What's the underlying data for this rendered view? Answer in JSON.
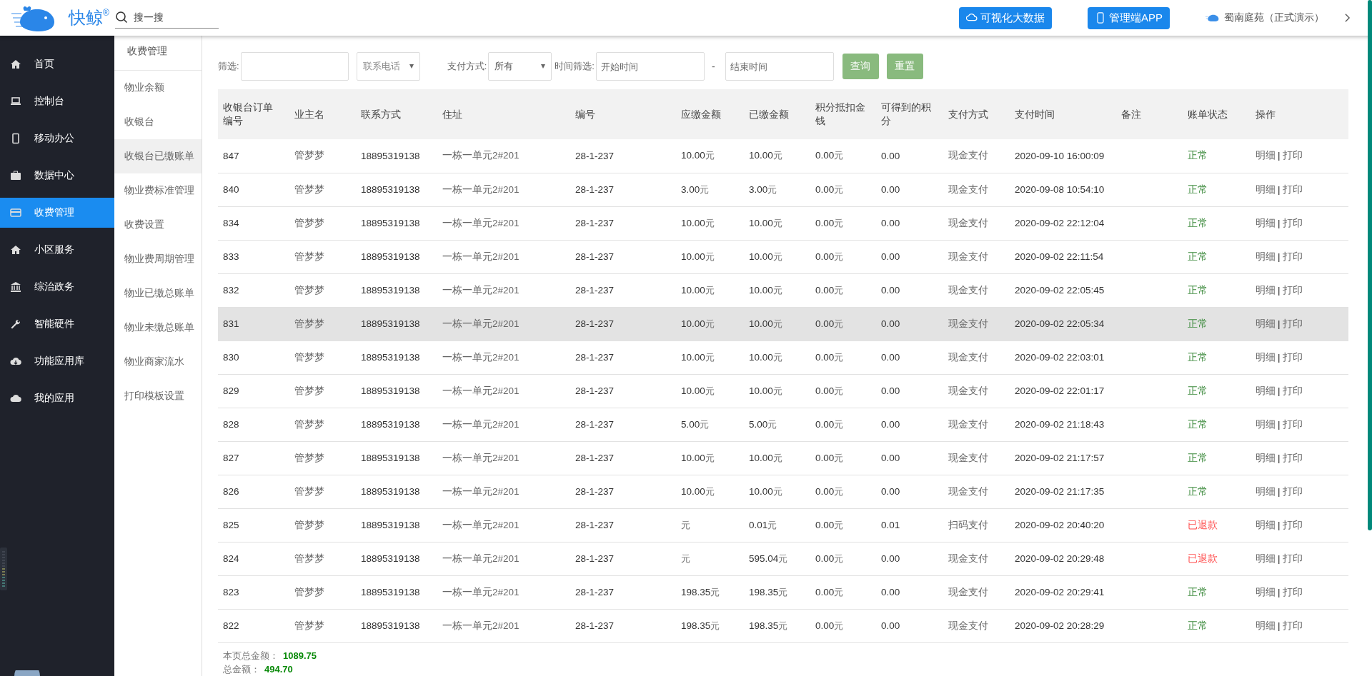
{
  "brand": {
    "name": "快鲸",
    "mark": "®"
  },
  "search": {
    "placeholder": "搜一搜"
  },
  "top_buttons": [
    {
      "label": "可视化大数据",
      "kind": "cloud"
    },
    {
      "label": "管理端APP",
      "kind": "phone"
    }
  ],
  "user": {
    "name": "蜀南庭苑（正式演示）"
  },
  "nav": [
    {
      "label": "首页",
      "kind": "home",
      "selected": false
    },
    {
      "label": "控制台",
      "kind": "laptop",
      "selected": false
    },
    {
      "label": "移动办公",
      "kind": "mobile",
      "selected": false
    },
    {
      "label": "数据中心",
      "kind": "briefcase",
      "selected": false
    },
    {
      "label": "收费管理",
      "kind": "card",
      "selected": true
    },
    {
      "label": "小区服务",
      "kind": "home",
      "selected": false
    },
    {
      "label": "综治政务",
      "kind": "bank",
      "selected": false
    },
    {
      "label": "智能硬件",
      "kind": "wrench",
      "selected": false
    },
    {
      "label": "功能应用库",
      "kind": "download",
      "selected": false
    },
    {
      "label": "我的应用",
      "kind": "cloud",
      "selected": false
    }
  ],
  "subnav": {
    "title": "收费管理",
    "items": [
      {
        "label": "物业余额",
        "selected": false
      },
      {
        "label": "收银台",
        "selected": false
      },
      {
        "label": "收银台已缴账单",
        "selected": true
      },
      {
        "label": "物业费标准管理",
        "selected": false
      },
      {
        "label": "收费设置",
        "selected": false
      },
      {
        "label": "物业费周期管理",
        "selected": false
      },
      {
        "label": "物业已缴总账单",
        "selected": false
      },
      {
        "label": "物业未缴总账单",
        "selected": false
      },
      {
        "label": "物业商家流水",
        "selected": false
      },
      {
        "label": "打印模板设置",
        "selected": false
      }
    ]
  },
  "filters": {
    "filter_label": "筛选:",
    "field_select": "联系电话",
    "pay_label": "支付方式:",
    "pay_select": "所有",
    "time_label": "时间筛选:",
    "start_placeholder": "开始时间",
    "range_sep": "-",
    "end_placeholder": "结束时间",
    "buttons": [
      "查询",
      "重置"
    ]
  },
  "table": {
    "columns": [
      "收银台订单编号",
      "业主名",
      "联系方式",
      "住址",
      "编号",
      "应缴金额",
      "已缴金额",
      "积分抵扣金钱",
      "可得到的积分",
      "支付方式",
      "支付时间",
      "备注",
      "账单状态",
      "操作"
    ],
    "action_separator": "|",
    "rows": [
      {
        "id": "847",
        "owner": "管梦梦",
        "phone": "18895319138",
        "address": "一栋一单元2#201",
        "code": "28-1-237",
        "due": {
          "value": "10.00",
          "unit": "元"
        },
        "paid": {
          "value": "10.00",
          "unit": "元"
        },
        "deduct": {
          "value": "0.00",
          "unit": "元"
        },
        "points": "0.00",
        "pay_method": "现金支付",
        "pay_time": "2020-09-10 16:00:09",
        "status": {
          "text": "正常",
          "kind": "normal"
        },
        "actions": [
          "明细",
          "打印"
        ],
        "highlighted": false
      },
      {
        "id": "840",
        "owner": "管梦梦",
        "phone": "18895319138",
        "address": "一栋一单元2#201",
        "code": "28-1-237",
        "due": {
          "value": "3.00",
          "unit": "元"
        },
        "paid": {
          "value": "3.00",
          "unit": "元"
        },
        "deduct": {
          "value": "0.00",
          "unit": "元"
        },
        "points": "0.00",
        "pay_method": "现金支付",
        "pay_time": "2020-09-08 10:54:10",
        "status": {
          "text": "正常",
          "kind": "normal"
        },
        "actions": [
          "明细",
          "打印"
        ],
        "highlighted": false
      },
      {
        "id": "834",
        "owner": "管梦梦",
        "phone": "18895319138",
        "address": "一栋一单元2#201",
        "code": "28-1-237",
        "due": {
          "value": "10.00",
          "unit": "元"
        },
        "paid": {
          "value": "10.00",
          "unit": "元"
        },
        "deduct": {
          "value": "0.00",
          "unit": "元"
        },
        "points": "0.00",
        "pay_method": "现金支付",
        "pay_time": "2020-09-02 22:12:04",
        "status": {
          "text": "正常",
          "kind": "normal"
        },
        "actions": [
          "明细",
          "打印"
        ],
        "highlighted": false
      },
      {
        "id": "833",
        "owner": "管梦梦",
        "phone": "18895319138",
        "address": "一栋一单元2#201",
        "code": "28-1-237",
        "due": {
          "value": "10.00",
          "unit": "元"
        },
        "paid": {
          "value": "10.00",
          "unit": "元"
        },
        "deduct": {
          "value": "0.00",
          "unit": "元"
        },
        "points": "0.00",
        "pay_method": "现金支付",
        "pay_time": "2020-09-02 22:11:54",
        "status": {
          "text": "正常",
          "kind": "normal"
        },
        "actions": [
          "明细",
          "打印"
        ],
        "highlighted": false
      },
      {
        "id": "832",
        "owner": "管梦梦",
        "phone": "18895319138",
        "address": "一栋一单元2#201",
        "code": "28-1-237",
        "due": {
          "value": "10.00",
          "unit": "元"
        },
        "paid": {
          "value": "10.00",
          "unit": "元"
        },
        "deduct": {
          "value": "0.00",
          "unit": "元"
        },
        "points": "0.00",
        "pay_method": "现金支付",
        "pay_time": "2020-09-02 22:05:45",
        "status": {
          "text": "正常",
          "kind": "normal"
        },
        "actions": [
          "明细",
          "打印"
        ],
        "highlighted": false
      },
      {
        "id": "831",
        "owner": "管梦梦",
        "phone": "18895319138",
        "address": "一栋一单元2#201",
        "code": "28-1-237",
        "due": {
          "value": "10.00",
          "unit": "元"
        },
        "paid": {
          "value": "10.00",
          "unit": "元"
        },
        "deduct": {
          "value": "0.00",
          "unit": "元"
        },
        "points": "0.00",
        "pay_method": "现金支付",
        "pay_time": "2020-09-02 22:05:34",
        "status": {
          "text": "正常",
          "kind": "normal"
        },
        "actions": [
          "明细",
          "打印"
        ],
        "highlighted": true
      },
      {
        "id": "830",
        "owner": "管梦梦",
        "phone": "18895319138",
        "address": "一栋一单元2#201",
        "code": "28-1-237",
        "due": {
          "value": "10.00",
          "unit": "元"
        },
        "paid": {
          "value": "10.00",
          "unit": "元"
        },
        "deduct": {
          "value": "0.00",
          "unit": "元"
        },
        "points": "0.00",
        "pay_method": "现金支付",
        "pay_time": "2020-09-02 22:03:01",
        "status": {
          "text": "正常",
          "kind": "normal"
        },
        "actions": [
          "明细",
          "打印"
        ],
        "highlighted": false
      },
      {
        "id": "829",
        "owner": "管梦梦",
        "phone": "18895319138",
        "address": "一栋一单元2#201",
        "code": "28-1-237",
        "due": {
          "value": "10.00",
          "unit": "元"
        },
        "paid": {
          "value": "10.00",
          "unit": "元"
        },
        "deduct": {
          "value": "0.00",
          "unit": "元"
        },
        "points": "0.00",
        "pay_method": "现金支付",
        "pay_time": "2020-09-02 22:01:17",
        "status": {
          "text": "正常",
          "kind": "normal"
        },
        "actions": [
          "明细",
          "打印"
        ],
        "highlighted": false
      },
      {
        "id": "828",
        "owner": "管梦梦",
        "phone": "18895319138",
        "address": "一栋一单元2#201",
        "code": "28-1-237",
        "due": {
          "value": "5.00",
          "unit": "元"
        },
        "paid": {
          "value": "5.00",
          "unit": "元"
        },
        "deduct": {
          "value": "0.00",
          "unit": "元"
        },
        "points": "0.00",
        "pay_method": "现金支付",
        "pay_time": "2020-09-02 21:18:43",
        "status": {
          "text": "正常",
          "kind": "normal"
        },
        "actions": [
          "明细",
          "打印"
        ],
        "highlighted": false
      },
      {
        "id": "827",
        "owner": "管梦梦",
        "phone": "18895319138",
        "address": "一栋一单元2#201",
        "code": "28-1-237",
        "due": {
          "value": "10.00",
          "unit": "元"
        },
        "paid": {
          "value": "10.00",
          "unit": "元"
        },
        "deduct": {
          "value": "0.00",
          "unit": "元"
        },
        "points": "0.00",
        "pay_method": "现金支付",
        "pay_time": "2020-09-02 21:17:57",
        "status": {
          "text": "正常",
          "kind": "normal"
        },
        "actions": [
          "明细",
          "打印"
        ],
        "highlighted": false
      },
      {
        "id": "826",
        "owner": "管梦梦",
        "phone": "18895319138",
        "address": "一栋一单元2#201",
        "code": "28-1-237",
        "due": {
          "value": "10.00",
          "unit": "元"
        },
        "paid": {
          "value": "10.00",
          "unit": "元"
        },
        "deduct": {
          "value": "0.00",
          "unit": "元"
        },
        "points": "0.00",
        "pay_method": "现金支付",
        "pay_time": "2020-09-02 21:17:35",
        "status": {
          "text": "正常",
          "kind": "normal"
        },
        "actions": [
          "明细",
          "打印"
        ],
        "highlighted": false
      },
      {
        "id": "825",
        "owner": "管梦梦",
        "phone": "18895319138",
        "address": "一栋一单元2#201",
        "code": "28-1-237",
        "due": {
          "unit": "元"
        },
        "paid": {
          "value": "0.01",
          "unit": "元"
        },
        "deduct": {
          "value": "0.00",
          "unit": "元"
        },
        "points": "0.01",
        "pay_method": "扫码支付",
        "pay_time": "2020-09-02 20:40:20",
        "status": {
          "text": "已退款",
          "kind": "refunded"
        },
        "actions": [
          "明细",
          "打印"
        ],
        "highlighted": false
      },
      {
        "id": "824",
        "owner": "管梦梦",
        "phone": "18895319138",
        "address": "一栋一单元2#201",
        "code": "28-1-237",
        "due": {
          "unit": "元"
        },
        "paid": {
          "value": "595.04",
          "unit": "元"
        },
        "deduct": {
          "value": "0.00",
          "unit": "元"
        },
        "points": "0.00",
        "pay_method": "现金支付",
        "pay_time": "2020-09-02 20:29:48",
        "status": {
          "text": "已退款",
          "kind": "refunded"
        },
        "actions": [
          "明细",
          "打印"
        ],
        "highlighted": false
      },
      {
        "id": "823",
        "owner": "管梦梦",
        "phone": "18895319138",
        "address": "一栋一单元2#201",
        "code": "28-1-237",
        "due": {
          "value": "198.35",
          "unit": "元"
        },
        "paid": {
          "value": "198.35",
          "unit": "元"
        },
        "deduct": {
          "value": "0.00",
          "unit": "元"
        },
        "points": "0.00",
        "pay_method": "现金支付",
        "pay_time": "2020-09-02 20:29:41",
        "status": {
          "text": "正常",
          "kind": "normal"
        },
        "actions": [
          "明细",
          "打印"
        ],
        "highlighted": false
      },
      {
        "id": "822",
        "owner": "管梦梦",
        "phone": "18895319138",
        "address": "一栋一单元2#201",
        "code": "28-1-237",
        "due": {
          "value": "198.35",
          "unit": "元"
        },
        "paid": {
          "value": "198.35",
          "unit": "元"
        },
        "deduct": {
          "value": "0.00",
          "unit": "元"
        },
        "points": "0.00",
        "pay_method": "现金支付",
        "pay_time": "2020-09-02 20:28:29",
        "status": {
          "text": "正常",
          "kind": "normal"
        },
        "actions": [
          "明细",
          "打印"
        ],
        "highlighted": false
      }
    ]
  },
  "totals": [
    {
      "label": "本页总金额：",
      "value": "1089.75"
    },
    {
      "label": "总金额：",
      "value": "494.70"
    }
  ]
}
